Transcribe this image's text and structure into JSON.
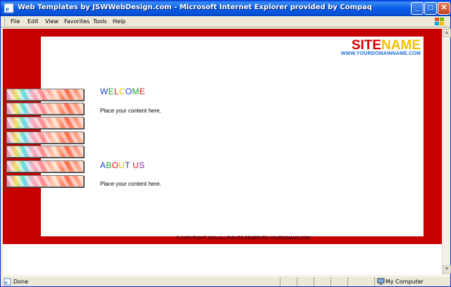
{
  "window": {
    "title": "Web Templates by JSWWebDesign.com - Microsoft Internet Explorer provided by Compaq",
    "minimize_label": "_",
    "maximize_label": "□",
    "close_label": "✕"
  },
  "menu": [
    "File",
    "Edit",
    "View",
    "Favorites",
    "Tools",
    "Help"
  ],
  "page": {
    "site_name_1": "SITE",
    "site_name_2": "NAME",
    "site_url": "WWW.YOURDOMAINNAME.COM",
    "welcome_heading": "WELCOME",
    "welcome_text": "Place your content here.",
    "about_heading": "ABOUT US",
    "about_text": "Place your content here.",
    "copyright": "© COPYRIGHT 2001 ALL RIGHTS RESERVED YOURDOMAIN.COM",
    "nav_buttons": 7
  },
  "status": {
    "left": "Done",
    "right": "My Computer"
  },
  "colors": {
    "frame_red": "#c60000",
    "site_red": "#d40000",
    "site_yellow": "#f2c200",
    "url_blue": "#1a6bd6"
  }
}
